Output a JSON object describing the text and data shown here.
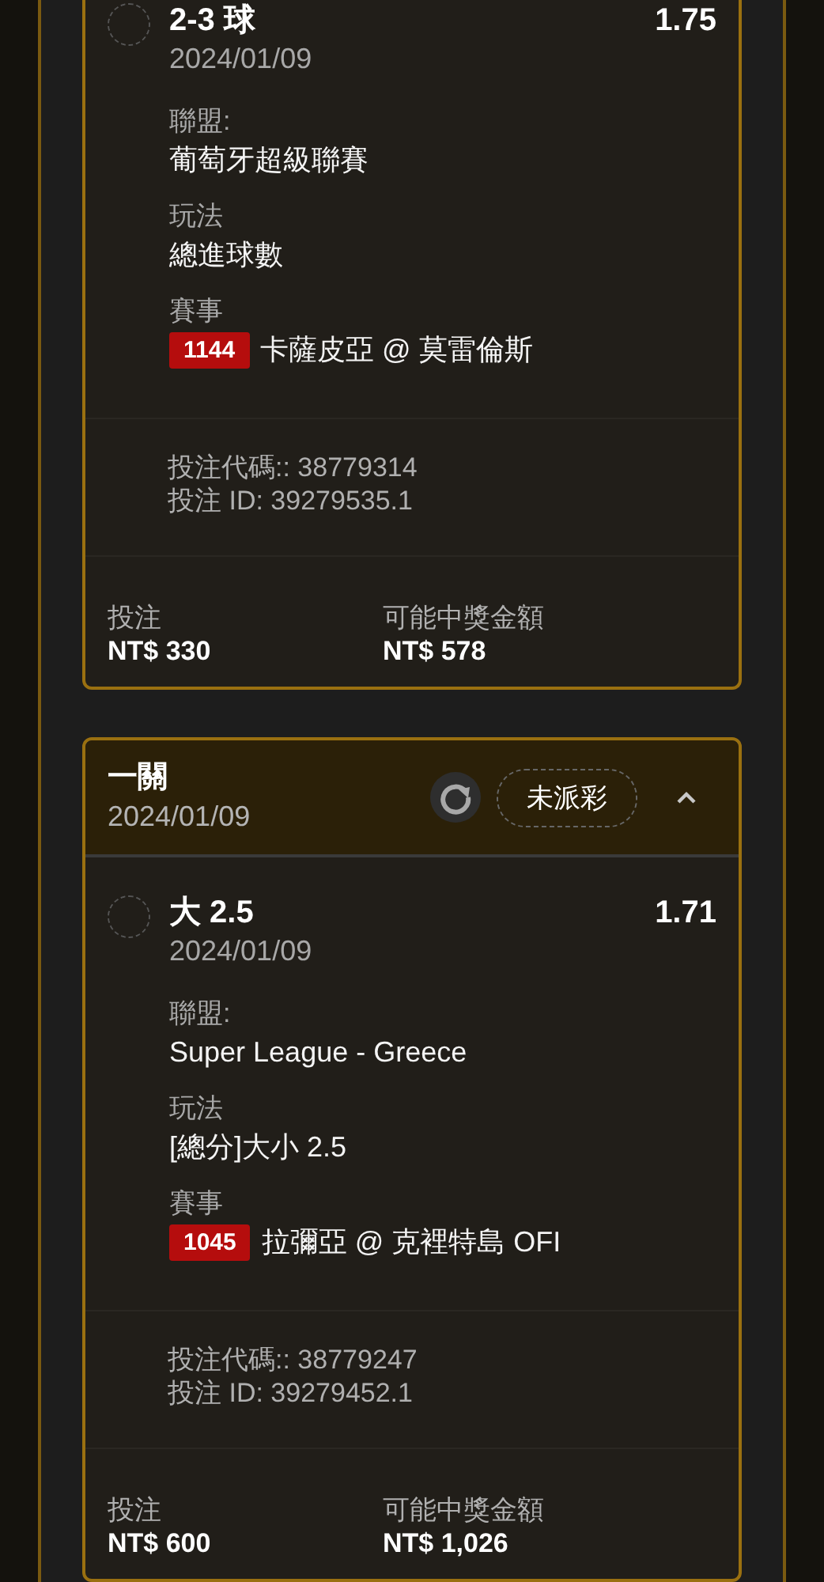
{
  "bets": [
    {
      "selection": {
        "name": "2-3 球",
        "date": "2024/01/09",
        "odds": "1.75",
        "selected": false
      },
      "league_label": "聯盟:",
      "league": "葡萄牙超級聯賽",
      "market_label": "玩法",
      "market": "總進球數",
      "event_label": "賽事",
      "event_id": "1144",
      "event_name": "卡薩皮亞 @ 莫雷倫斯",
      "ticket_code": "投注代碼:: 38779314",
      "bet_id": "投注 ID: 39279535.1",
      "stake_label": "投注",
      "stake": "NT$ 330",
      "payout_label": "可能中獎金額",
      "payout": "NT$ 578"
    },
    {
      "header": {
        "title": "一關",
        "date": "2024/01/09",
        "status": "未派彩"
      },
      "expanded": true,
      "selection": {
        "name": "大 2.5",
        "date": "2024/01/09",
        "odds": "1.71",
        "selected": false
      },
      "league_label": "聯盟:",
      "league": "Super League - Greece",
      "market_label": "玩法",
      "market": "[總分]大小 2.5",
      "event_label": "賽事",
      "event_id": "1045",
      "event_name": "拉彌亞 @ 克裡特島 OFI",
      "ticket_code": "投注代碼:: 38779247",
      "bet_id": "投注 ID: 39279452.1",
      "stake_label": "投注",
      "stake": "NT$ 600",
      "payout_label": "可能中獎金額",
      "payout": "NT$ 1,026"
    }
  ]
}
